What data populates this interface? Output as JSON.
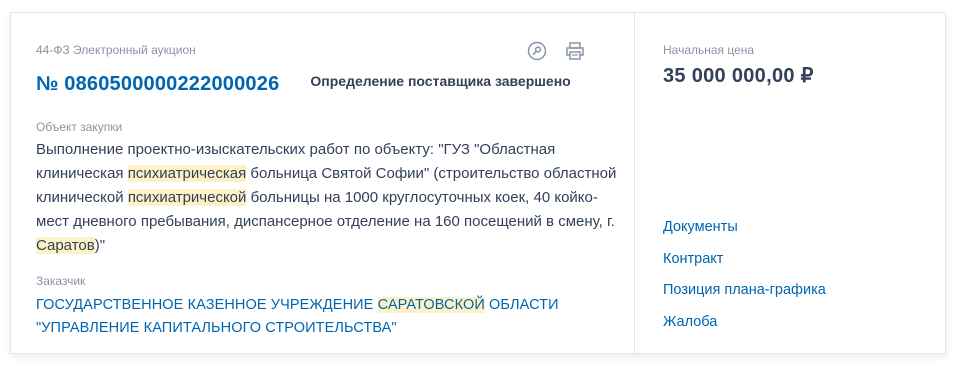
{
  "purchase": {
    "law_type": "44-ФЗ Электронный аукцион",
    "number": "№ 0860500000222000026",
    "status": "Определение поставщика завершено",
    "object_label": "Объект закупки",
    "object_parts": [
      "Выполнение проектно-изыскательских работ по объекту: \"ГУЗ \"Областная клиническая ",
      "психиатрическая",
      " больница Святой Софии\" (строительство областной клинической ",
      "психиатрической",
      " больницы на 1000 круглосуточных коек, 40 койко-мест дневного пребывания, диспансерное отделение на 160 посещений в смену, г. ",
      "Саратов",
      ")\""
    ],
    "customer_label": "Заказчик",
    "customer_parts": [
      "ГОСУДАРСТВЕННОЕ КАЗЕННОЕ УЧРЕЖДЕНИЕ ",
      "САРАТОВСКОЙ",
      " ОБЛАСТИ \"УПРАВЛЕНИЕ КАПИТАЛЬНОГО СТРОИТЕЛЬСТВА\""
    ]
  },
  "price": {
    "label": "Начальная цена",
    "value": "35 000 000,00 ₽"
  },
  "links": {
    "documents": "Документы",
    "contract": "Контракт",
    "plan_position": "Позиция плана-графика",
    "complaint": "Жалоба"
  },
  "icons": {
    "magnifier": "search-key-icon",
    "print": "print-icon"
  },
  "colors": {
    "link": "#0065b1",
    "highlight": "#fdf2c5",
    "muted": "#8a94a5",
    "text": "#334059"
  }
}
